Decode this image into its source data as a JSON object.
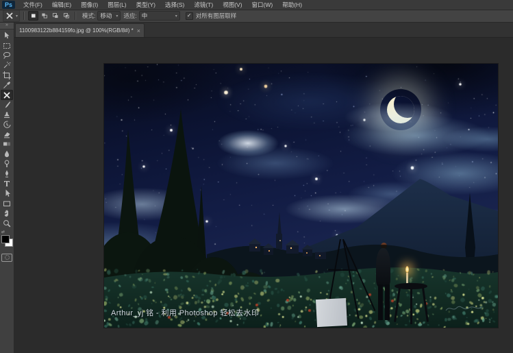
{
  "menu_bar": {
    "logo": "Ps",
    "items": [
      {
        "name": "menu-file",
        "label": "文件(F)"
      },
      {
        "name": "menu-edit",
        "label": "编辑(E)"
      },
      {
        "name": "menu-image",
        "label": "图像(I)"
      },
      {
        "name": "menu-layer",
        "label": "图层(L)"
      },
      {
        "name": "menu-type",
        "label": "类型(Y)"
      },
      {
        "name": "menu-select",
        "label": "选择(S)"
      },
      {
        "name": "menu-filter",
        "label": "滤镜(T)"
      },
      {
        "name": "menu-view",
        "label": "视图(V)"
      },
      {
        "name": "menu-window",
        "label": "窗口(W)"
      },
      {
        "name": "menu-help",
        "label": "帮助(H)"
      }
    ]
  },
  "options_bar": {
    "active_tool_icon": "content-aware-move-tool-icon",
    "selection_modes": [
      {
        "icon": "new-selection-icon",
        "active": true
      },
      {
        "icon": "add-to-selection-icon",
        "active": false
      },
      {
        "icon": "subtract-from-selection-icon",
        "active": false
      },
      {
        "icon": "intersect-selection-icon",
        "active": false
      }
    ],
    "mode_label": "模式:",
    "mode_value": "移动",
    "adapt_label": "适应:",
    "adapt_value": "中",
    "sample_all_layers_label": "对所有图层取样",
    "sample_all_layers_checked": true
  },
  "document_tab": {
    "title": "1100983122b884159fo.jpg @ 100%(RGB/8#) *",
    "close": "×"
  },
  "toolbar": {
    "collapse_glyph": "»",
    "tools": [
      {
        "icon": "move-tool-icon",
        "selected": false
      },
      {
        "icon": "rectangular-marquee-tool-icon",
        "selected": false
      },
      {
        "icon": "lasso-tool-icon",
        "selected": false
      },
      {
        "icon": "quick-selection-tool-icon",
        "selected": false
      },
      {
        "icon": "crop-tool-icon",
        "selected": false
      },
      {
        "icon": "eyedropper-tool-icon",
        "selected": false
      },
      {
        "icon": "content-aware-move-tool-icon",
        "selected": true
      },
      {
        "icon": "brush-tool-icon",
        "selected": false
      },
      {
        "icon": "clone-stamp-tool-icon",
        "selected": false
      },
      {
        "icon": "history-brush-tool-icon",
        "selected": false
      },
      {
        "icon": "eraser-tool-icon",
        "selected": false
      },
      {
        "icon": "gradient-tool-icon",
        "selected": false
      },
      {
        "icon": "blur-tool-icon",
        "selected": false
      },
      {
        "icon": "dodge-tool-icon",
        "selected": false
      },
      {
        "icon": "pen-tool-icon",
        "selected": false
      },
      {
        "icon": "type-tool-icon",
        "selected": false
      },
      {
        "icon": "path-selection-tool-icon",
        "selected": false
      },
      {
        "icon": "shape-tool-icon",
        "selected": false
      },
      {
        "icon": "hand-tool-icon",
        "selected": false
      },
      {
        "icon": "zoom-tool-icon",
        "selected": false
      }
    ],
    "foreground_color": "#000000",
    "background_color": "#ffffff"
  },
  "canvas": {
    "watermark": "Arthur_yj 铭 - 利用 Photoshop 轻松去水印"
  },
  "icons": {
    "caret": "▾",
    "check": "✓"
  },
  "colors": {
    "ui_menubar": "#3a3a3a",
    "ui_optionsbar": "#434343",
    "ui_toolbar": "#404040",
    "ui_canvas_surround": "#2b2b2b",
    "accent_blue": "#57b6f5",
    "sky_deep": "#0c1434",
    "cloud_light": "#bcd8ea",
    "moon": "#fbf3d2",
    "field_green": "#143028",
    "candle_flame": "#ffcf6e"
  }
}
